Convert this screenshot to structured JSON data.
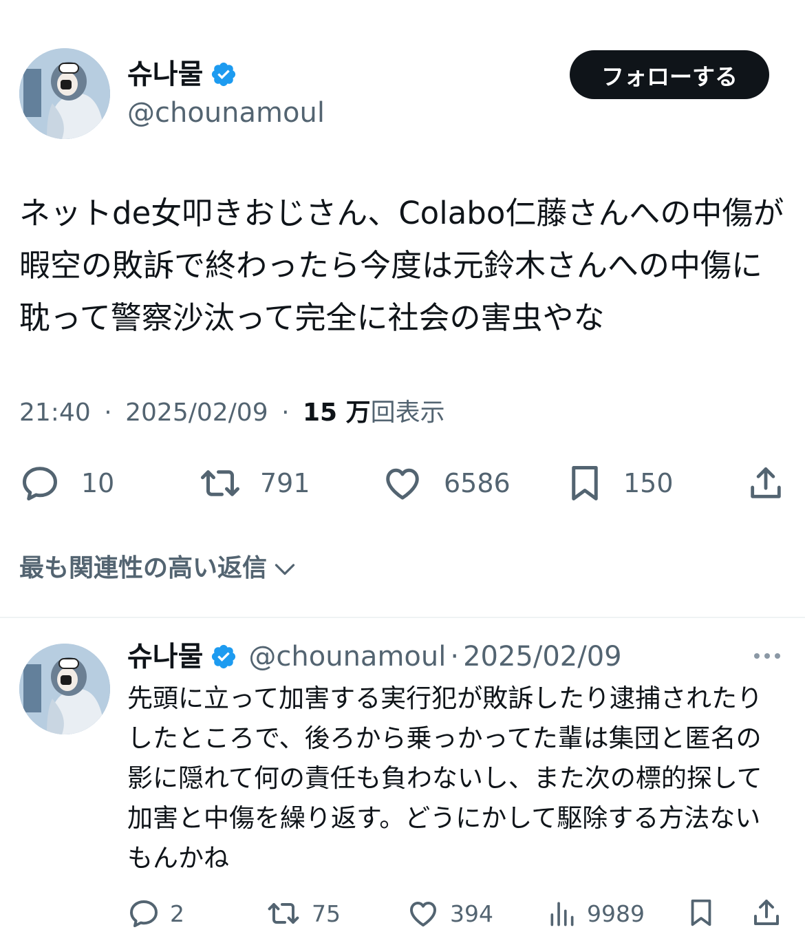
{
  "colors": {
    "text_primary": "#0f1419",
    "text_secondary": "#536471",
    "verified_badge": "#1d9bf0",
    "follow_button_bg": "#0f1419",
    "divider": "#eff3f4"
  },
  "tweet": {
    "author": {
      "display_name": "슈나물",
      "handle": "@chounamoul",
      "verified": true,
      "avatar_icon": "anime-avatar"
    },
    "follow_label": "フォローする",
    "text": "ネットde女叩きおじさん、Colabo仁藤さんへの中傷が暇空の敗訴で終わったら今度は元鈴木さんへの中傷に耽って警察沙汰って完全に社会の害虫やな",
    "time": "21:40",
    "date": "2025/02/09",
    "separator": "·",
    "views_count": "15 万",
    "views_label": "回表示",
    "actions": {
      "replies": "10",
      "retweets": "791",
      "likes": "6586",
      "bookmarks": "150",
      "share_icon": "share-icon"
    }
  },
  "replies_sort": {
    "label": "最も関連性の高い返信",
    "icon": "chevron-down-icon"
  },
  "reply": {
    "author": {
      "display_name": "슈나물",
      "handle": "@chounamoul",
      "verified": true
    },
    "separator": "·",
    "date": "2025/02/09",
    "more_icon": "more-icon",
    "text": "先頭に立って加害する実行犯が敗訴したり逮捕されたりしたところで、後ろから乗っかってた輩は集団と匿名の影に隠れて何の責任も負わないし、また次の標的探して加害と中傷を繰り返す。どうにかして駆除する方法ないもんかね",
    "actions": {
      "replies": "2",
      "retweets": "75",
      "likes": "394",
      "views": "9989"
    }
  }
}
